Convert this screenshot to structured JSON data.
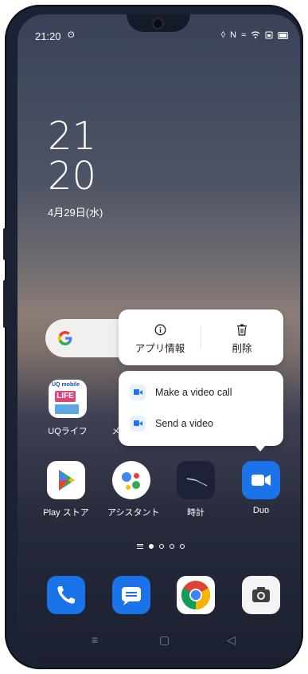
{
  "status": {
    "time": "21:20",
    "icons": [
      "alarm-icon",
      "nfc-icon",
      "vibrate-icon",
      "wifi-icon",
      "sim-icon",
      "battery-icon"
    ]
  },
  "clock": {
    "hour": "21",
    "minute": "20",
    "date": "4月29日(水)"
  },
  "context_menu": {
    "app_info": "アプリ情報",
    "delete": "削除"
  },
  "shortcuts": [
    {
      "label": "Make a video call"
    },
    {
      "label": "Send a video"
    }
  ],
  "apps_row1": [
    {
      "label": "UQライフ"
    },
    {
      "label": "メ"
    }
  ],
  "apps_row2": [
    {
      "label": "Play ストア"
    },
    {
      "label": "アシスタント"
    },
    {
      "label": "時計"
    },
    {
      "label": "Duo"
    }
  ],
  "dock": [
    "phone",
    "messages",
    "chrome",
    "camera"
  ],
  "page_indicator": {
    "pages": 4,
    "current": 1
  },
  "colors": {
    "duo": "#1a73e8",
    "phone": "#1a73e8",
    "menu_bg": "#ffffff"
  }
}
